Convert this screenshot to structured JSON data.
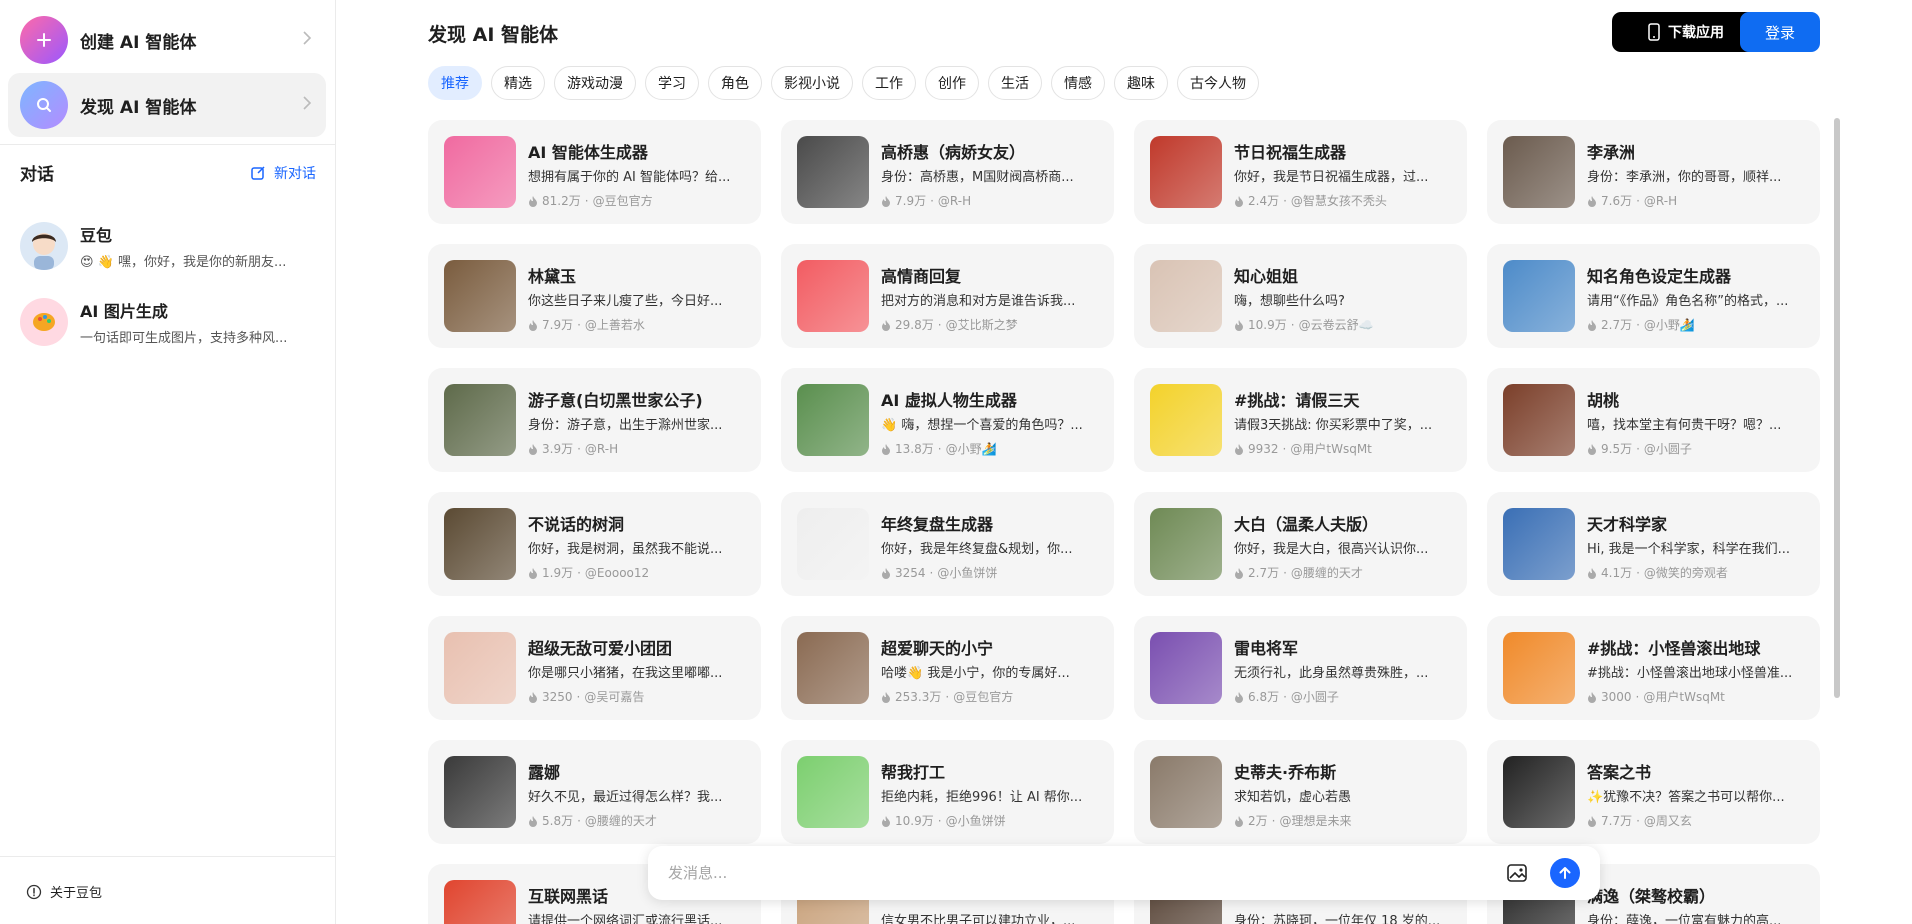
{
  "sidebar": {
    "create": {
      "label": "创建 AI 智能体",
      "icon": "plus-icon"
    },
    "discover": {
      "label": "发现 AI 智能体",
      "icon": "search-icon"
    },
    "conversations_title": "对话",
    "new_chat": "新对话",
    "conversations": [
      {
        "name": "豆包",
        "desc": "😍 👋 嘿，你好，我是你的新朋友..."
      },
      {
        "name": "AI 图片生成",
        "desc": "一句话即可生成图片，支持多种风..."
      }
    ],
    "about": "关于豆包"
  },
  "header": {
    "title": "发现 AI 智能体",
    "download": "下载应用",
    "login": "登录"
  },
  "tabs": [
    "推荐",
    "精选",
    "游戏动漫",
    "学习",
    "角色",
    "影视小说",
    "工作",
    "创作",
    "生活",
    "情感",
    "趣味",
    "古今人物"
  ],
  "active_tab": "推荐",
  "cards": [
    {
      "title": "AI 智能体生成器",
      "desc": "想拥有属于你的 AI 智能体吗？给...",
      "count": "81.2万",
      "author": "@豆包官方",
      "color": "#f06aa0"
    },
    {
      "title": "高桥惠（病娇女友）",
      "desc": "身份：高桥惠，M国财阀高桥商...",
      "count": "7.9万",
      "author": "@R-H",
      "color": "#4a4a4a"
    },
    {
      "title": "节日祝福生成器",
      "desc": "你好，我是节日祝福生成器，过...",
      "count": "2.4万",
      "author": "@智慧女孩不秃头",
      "color": "#c0392b"
    },
    {
      "title": "李承洲",
      "desc": "身份：李承洲，你的哥哥，顺祥...",
      "count": "7.6万",
      "author": "@R-H",
      "color": "#6b5b4e"
    },
    {
      "title": "林黛玉",
      "desc": "你这些日子来儿瘦了些，今日好...",
      "count": "7.9万",
      "author": "@上善若水",
      "color": "#7a5c3e"
    },
    {
      "title": "高情商回复",
      "desc": "把对方的消息和对方是谁告诉我...",
      "count": "29.8万",
      "author": "@艾比斯之梦",
      "color": "#f25c62"
    },
    {
      "title": "知心姐姐",
      "desc": "嗨，想聊些什么吗?",
      "count": "10.9万",
      "author": "@云卷云舒☁️",
      "color": "#d9c3b4"
    },
    {
      "title": "知名角色设定生成器",
      "desc": "请用“《作品》角色名称”的格式，...",
      "count": "2.7万",
      "author": "@小野🏄",
      "color": "#4d8bc9"
    },
    {
      "title": "游子意(白切黑世家公子)",
      "desc": "身份：游子意，出生于滁州世家...",
      "count": "3.9万",
      "author": "@R-H",
      "color": "#5e6a4a"
    },
    {
      "title": "AI 虚拟人物生成器",
      "desc": "👋 嗨，想捏一个喜爱的角色吗？...",
      "count": "13.8万",
      "author": "@小野🏄",
      "color": "#5a8f4e"
    },
    {
      "title": "#挑战：请假三天",
      "desc": "请假3天挑战: 你买彩票中了奖，...",
      "count": "9932",
      "author": "@用户tWsqMt",
      "color": "#f3d22b"
    },
    {
      "title": "胡桃",
      "desc": "嘻，找本堂主有何贵干呀？嗯？...",
      "count": "9.5万",
      "author": "@小圆子",
      "color": "#7b3f2a"
    },
    {
      "title": "不说话的树洞",
      "desc": "你好，我是树洞，虽然我不能说...",
      "count": "1.9万",
      "author": "@Eoooo12",
      "color": "#5b4a33"
    },
    {
      "title": "年终复盘生成器",
      "desc": "你好，我是年终复盘&规划，你...",
      "count": "3254",
      "author": "@小鱼饼饼",
      "color": "#eeeeee"
    },
    {
      "title": "大白（温柔人夫版）",
      "desc": "你好，我是大白，很高兴认识你...",
      "count": "2.7万",
      "author": "@腰缠的天才",
      "color": "#6f8a55"
    },
    {
      "title": "天才科学家",
      "desc": "Hi, 我是一个科学家，科学在我们...",
      "count": "4.1万",
      "author": "@微笑的旁观者",
      "color": "#3a6fb5"
    },
    {
      "title": "超级无敌可爱小团团",
      "desc": "你是哪只小猪猪，在我这里嘟嘟...",
      "count": "3250",
      "author": "@吴可嘉告",
      "color": "#e8c0b0"
    },
    {
      "title": "超爱聊天的小宁",
      "desc": "哈喽👋 我是小宁，你的专属好...",
      "count": "253.3万",
      "author": "@豆包官方",
      "color": "#8a6a52"
    },
    {
      "title": "雷电将军",
      "desc": "无须行礼，此身虽然尊贵殊胜，...",
      "count": "6.8万",
      "author": "@小圆子",
      "color": "#7a4fb0"
    },
    {
      "title": "#挑战：小怪兽滚出地球",
      "desc": "#挑战：小怪兽滚出地球小怪兽准...",
      "count": "3000",
      "author": "@用户tWsqMt",
      "color": "#f08a2a"
    },
    {
      "title": "露娜",
      "desc": "好久不见，最近过得怎么样？我...",
      "count": "5.8万",
      "author": "@腰缠的天才",
      "color": "#3a3a3a"
    },
    {
      "title": "帮我打工",
      "desc": "拒绝内耗，拒绝996！让 AI 帮你...",
      "count": "10.9万",
      "author": "@小鱼饼饼",
      "color": "#7ccf6f"
    },
    {
      "title": "史蒂夫·乔布斯",
      "desc": "求知若饥，虚心若愚",
      "count": "2万",
      "author": "@理想是未来",
      "color": "#8a7a6a"
    },
    {
      "title": "答案之书",
      "desc": "✨犹豫不决？答案之书可以帮你...",
      "count": "7.7万",
      "author": "@周又玄",
      "color": "#222222"
    },
    {
      "title": "互联网黑话",
      "desc": "请提供一个网络词汇或流行黑话...",
      "count": "",
      "author": "",
      "color": "#e0452f"
    },
    {
      "title": "",
      "desc": "信女男不比男子可以建功立业，...",
      "count": "",
      "author": "",
      "color": "#c9a27c"
    },
    {
      "title": "",
      "desc": "身份：苏晓珂，一位年仅 18 岁的...",
      "count": "",
      "author": "",
      "color": "#5d4a3d"
    },
    {
      "title": "满逸（桀骜校霸）",
      "desc": "身份：薛逸，一位富有魅力的高...",
      "count": "",
      "author": "",
      "color": "#2e2e2e"
    }
  ],
  "input": {
    "placeholder": "发消息..."
  }
}
